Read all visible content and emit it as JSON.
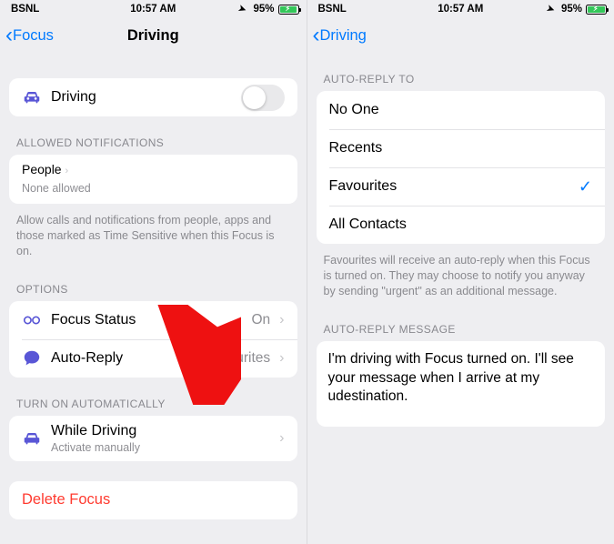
{
  "statusbar": {
    "carrier": "BSNL",
    "time": "10:57 AM",
    "battery_pct": "95%",
    "loc_glyph": "➤"
  },
  "left": {
    "back_label": "Focus",
    "title": "Driving",
    "toggle": {
      "title": "Driving"
    },
    "allowed_head": "ALLOWED NOTIFICATIONS",
    "people": {
      "title": "People",
      "sub": "None allowed"
    },
    "allowed_footer": "Allow calls and notifications from people, apps and those marked as Time Sensitive when this Focus is on.",
    "options_head": "OPTIONS",
    "focus_status": {
      "label": "Focus Status",
      "value": "On"
    },
    "auto_reply": {
      "label": "Auto-Reply",
      "value": "Favourites"
    },
    "auto_on_head": "TURN ON AUTOMATICALLY",
    "while_driving": {
      "label": "While Driving",
      "sub": "Activate manually"
    },
    "delete": "Delete Focus"
  },
  "right": {
    "back_label": "Driving",
    "auto_reply_to_head": "AUTO-REPLY TO",
    "options": {
      "noone": "No One",
      "recents": "Recents",
      "favourites": "Favourites",
      "allcontacts": "All Contacts"
    },
    "selected": "favourites",
    "auto_reply_to_footer": "Favourites will receive an auto-reply when this Focus is turned on. They may choose to notify you anyway by sending \"urgent\" as an additional message.",
    "msg_head": "AUTO-REPLY MESSAGE",
    "message": "I'm driving with Focus turned on. I'll see your message when I arrive at my udestination."
  },
  "colors": {
    "accent": "#007aff",
    "purple": "#5956d6",
    "danger": "#ff3b30",
    "green": "#33c759"
  }
}
